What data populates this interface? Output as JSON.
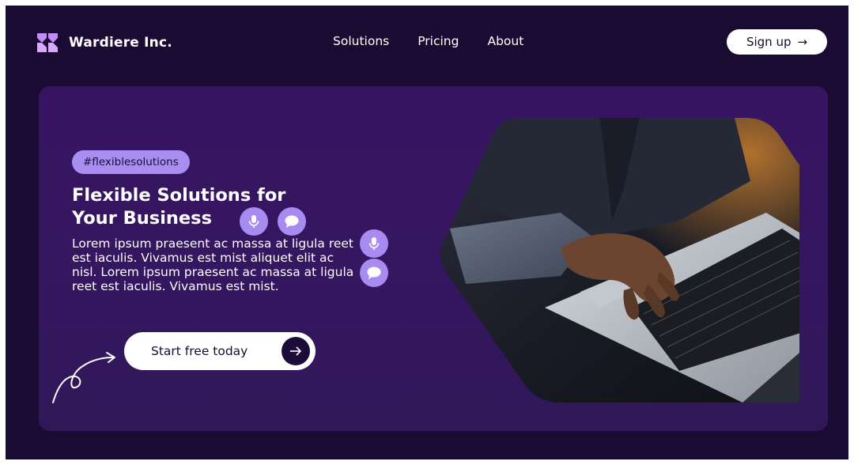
{
  "brand": {
    "name": "Wardiere Inc.",
    "logo_icon": "stacked-chevron-logo-icon"
  },
  "nav": {
    "items": [
      "Solutions",
      "Pricing",
      "About"
    ]
  },
  "signup": {
    "label": "Sign up",
    "arrow": "→"
  },
  "hero": {
    "tag": "#flexiblesolutions",
    "title_line1": "Flexible Solutions for",
    "title_line2": "Your Business",
    "body": "Lorem ipsum praesent ac massa at ligula reet est iaculis. Vivamus est mist aliquet elit ac nisl. Lorem ipsum praesent ac massa at ligula reet est iaculis. Vivamus est mist.",
    "cta_label": "Start free today",
    "cta_arrow": "→",
    "photo_description": "hands-typing-on-laptop-photo"
  },
  "colors": {
    "background": "#1a0b33",
    "card": "#361462",
    "accent": "#a98ef2",
    "logo": "#c08cf5",
    "text": "#ffffff"
  }
}
